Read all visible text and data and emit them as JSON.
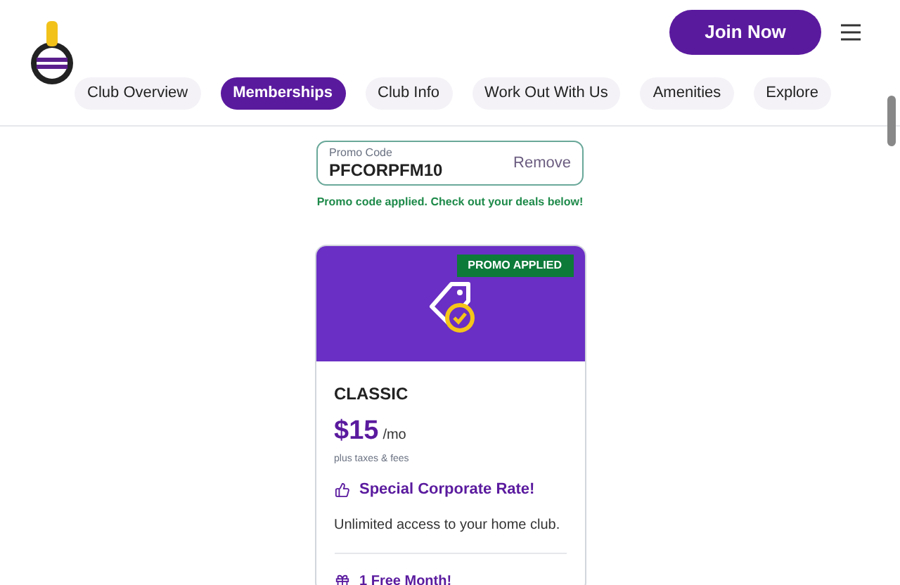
{
  "header": {
    "join_button": "Join Now"
  },
  "nav_tabs": [
    {
      "label": "Club Overview",
      "selected": false
    },
    {
      "label": "Memberships",
      "selected": true
    },
    {
      "label": "Club Info",
      "selected": false
    },
    {
      "label": "Work Out With Us",
      "selected": false
    },
    {
      "label": "Amenities",
      "selected": false
    },
    {
      "label": "Explore",
      "selected": false
    }
  ],
  "promo": {
    "label": "Promo Code",
    "value": "PFCORPFM10",
    "remove": "Remove",
    "message": "Promo code applied. Check out your deals below!"
  },
  "card": {
    "badge": "PROMO APPLIED",
    "name": "CLASSIC",
    "price": "$15",
    "period": "/mo",
    "taxes": "plus taxes & fees",
    "rate": "Special Corporate Rate!",
    "description": "Unlimited access to your home club.",
    "perk": "1 Free Month!"
  }
}
